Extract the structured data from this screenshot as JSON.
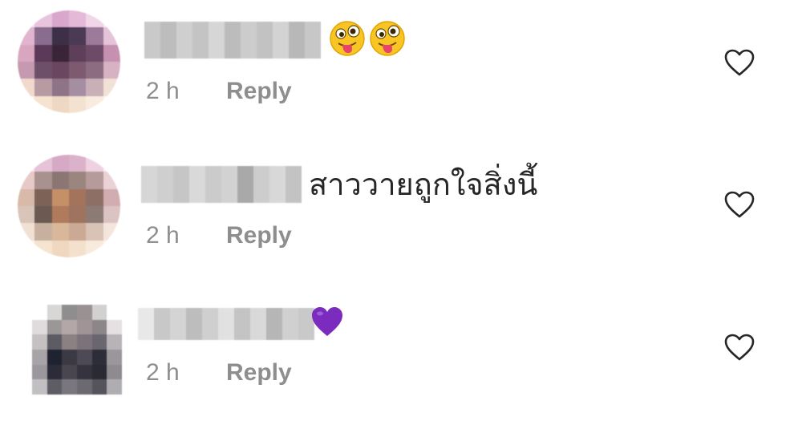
{
  "comments": [
    {
      "time": "2 h",
      "reply_label": "Reply",
      "text": "",
      "emoji": [
        "winking-face-with-tongue",
        "winking-face-with-tongue"
      ]
    },
    {
      "time": "2 h",
      "reply_label": "Reply",
      "text": "สาววายถูกใจสิ่งนี้",
      "emoji": []
    },
    {
      "time": "2 h",
      "reply_label": "Reply",
      "text": "",
      "emoji": [
        "purple-heart"
      ]
    }
  ],
  "colors": {
    "meta_text": "#8e8e8e",
    "comment_text": "#262626",
    "heart_outline": "#262626",
    "purple_heart": "#7b2cbf"
  },
  "icons": [
    "heart-outline-icon",
    "winking-face-with-tongue-icon",
    "purple-heart-icon"
  ]
}
